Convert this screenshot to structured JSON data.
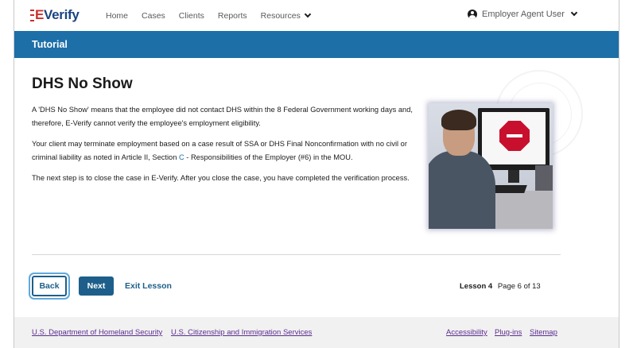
{
  "header": {
    "logo": {
      "prefix": "E",
      "suffix": "Verify"
    },
    "nav": [
      {
        "label": "Home"
      },
      {
        "label": "Cases"
      },
      {
        "label": "Clients"
      },
      {
        "label": "Reports"
      },
      {
        "label": "Resources"
      }
    ],
    "user_label": "Employer Agent User"
  },
  "tutorial_bar": {
    "title": "Tutorial"
  },
  "content": {
    "title": "DHS No Show",
    "paragraph1": "A 'DHS No Show' means that the employee did not contact DHS within the 8 Federal Government working days and, therefore, E-Verify cannot verify the employee's employment eligibility.",
    "paragraph2_before": "Your client may terminate employment based on a case result of SSA or DHS Final Nonconfirmation with no civil or criminal liability as noted in Article II, Section ",
    "paragraph2_highlight": "C",
    "paragraph2_after": " - Responsibilities of the Employer (#6) in the MOU.",
    "paragraph3": "The next step is to close the case in E-Verify. After you close the case, you have completed the verification process."
  },
  "controls": {
    "back_label": "Back",
    "next_label": "Next",
    "exit_label": "Exit Lesson",
    "lesson_label": "Lesson 4",
    "page_label": "Page 6 of 13"
  },
  "footer": {
    "left_links": [
      {
        "label": "U.S. Department of Homeland Security"
      },
      {
        "label": "U.S. Citizenship and Immigration Services"
      }
    ],
    "right_links": [
      {
        "label": "Accessibility"
      },
      {
        "label": "Plug-ins"
      },
      {
        "label": "Sitemap"
      }
    ]
  },
  "icons": {
    "user": "user-circle-icon",
    "chevron": "chevron-down-icon",
    "stop_sign": "stop-sign-icon",
    "seal": "dhs-seal-watermark"
  },
  "colors": {
    "brand_blue": "#1d6fa8",
    "button_blue": "#1d5f8a",
    "logo_red": "#c9302c",
    "footer_link": "#5c2e91"
  }
}
